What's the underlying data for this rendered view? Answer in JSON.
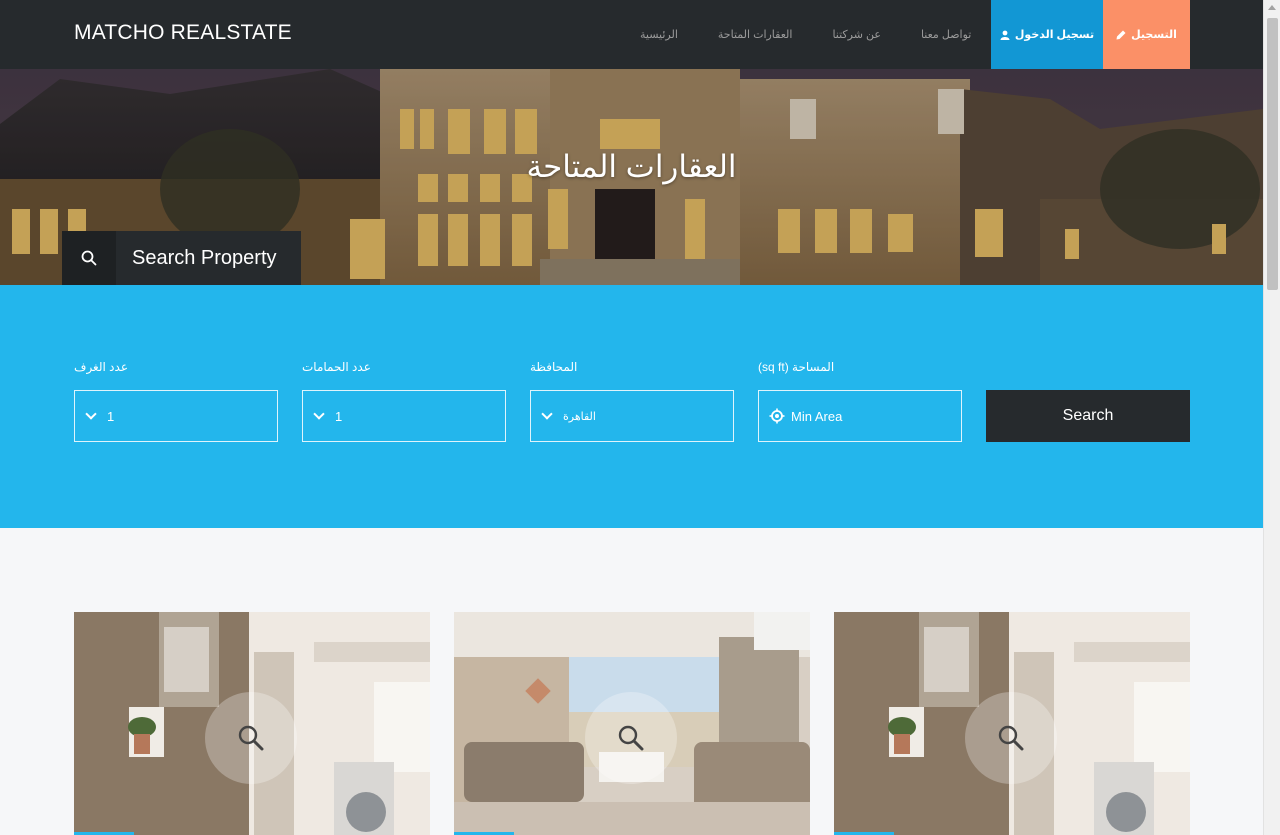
{
  "nav": {
    "brand": "MATCHO REALSTATE",
    "links": [
      "الرئيسية",
      "العقارات المتاحة",
      "عن شركتنا",
      "تواصل معنا"
    ],
    "login_label": "تسجيل الدخول",
    "register_label": "التسجيل",
    "login_color": "#1297d4",
    "register_color": "#fb9067"
  },
  "hero": {
    "title": "العقارات المتاحة",
    "search_tab_label": "Search Property",
    "search_icon": "search-icon"
  },
  "filters": {
    "rooms": {
      "label": "عدد الغرف",
      "value": "1"
    },
    "bathrooms": {
      "label": "عدد الحمامات",
      "value": "1"
    },
    "governorate": {
      "label": "المحافظة",
      "value": "القاهرة"
    },
    "area": {
      "label": "المساحة (sq ft)",
      "placeholder": "Min Area",
      "icon": "location-target-icon"
    },
    "search_label": "Search",
    "accent_color": "#23b6ec"
  },
  "listings": {
    "cards": [
      {
        "icon": "zoom-icon"
      },
      {
        "icon": "zoom-icon"
      },
      {
        "icon": "zoom-icon"
      }
    ]
  }
}
